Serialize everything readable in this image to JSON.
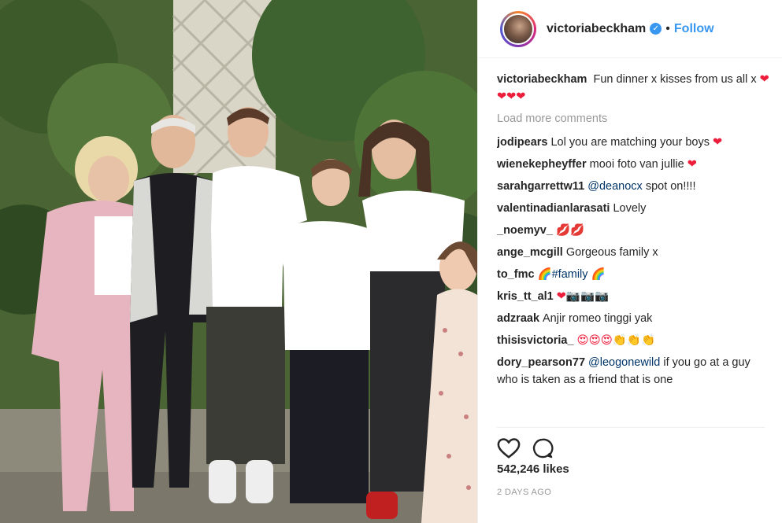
{
  "photo": {
    "description_icon": "family-photo"
  },
  "header": {
    "username": "victoriabeckham",
    "verified_icon": "verified-badge-icon",
    "separator": "•",
    "follow_label": "Follow"
  },
  "caption": {
    "user": "victoriabeckham",
    "text": "Fun dinner x kisses from us all x",
    "emoji": "❤❤❤❤"
  },
  "load_more_label": "Load more comments",
  "comments": [
    {
      "user": "jodipears",
      "text": "Lol you are matching your boys",
      "emoji": "❤"
    },
    {
      "user": "wienekepheyffer",
      "text": "mooi foto van jullie",
      "emoji": "❤"
    },
    {
      "user": "sarahgarrettw11",
      "mention": "@deanocx",
      "text": "spot on!!!!",
      "emoji": ""
    },
    {
      "user": "valentinadianlarasati",
      "text": "Lovely",
      "emoji": ""
    },
    {
      "user": "_noemyv_",
      "text": "",
      "emoji": "💋💋"
    },
    {
      "user": "ange_mcgill",
      "text": "Gorgeous family x",
      "emoji": ""
    },
    {
      "user": "to_fmc",
      "mention": "🌈#family",
      "text": "",
      "emoji": "🌈"
    },
    {
      "user": "kris_tt_al1",
      "text": "",
      "emoji": "❤📷📷📷"
    },
    {
      "user": "adzraak",
      "text": "Anjir romeo tinggi yak",
      "emoji": ""
    },
    {
      "user": "thisisvictoria_",
      "text": "",
      "emoji": "😍😍😍👏👏👏"
    },
    {
      "user": "dory_pearson77",
      "mention": "@leogonewild",
      "text": "if you go at a guy who is taken as a friend that is one",
      "emoji": ""
    }
  ],
  "actions": {
    "like_icon": "heart-outline-icon",
    "comment_icon": "comment-bubble-icon"
  },
  "likes_text": "542,246 likes",
  "time_text": "2 DAYS AGO"
}
